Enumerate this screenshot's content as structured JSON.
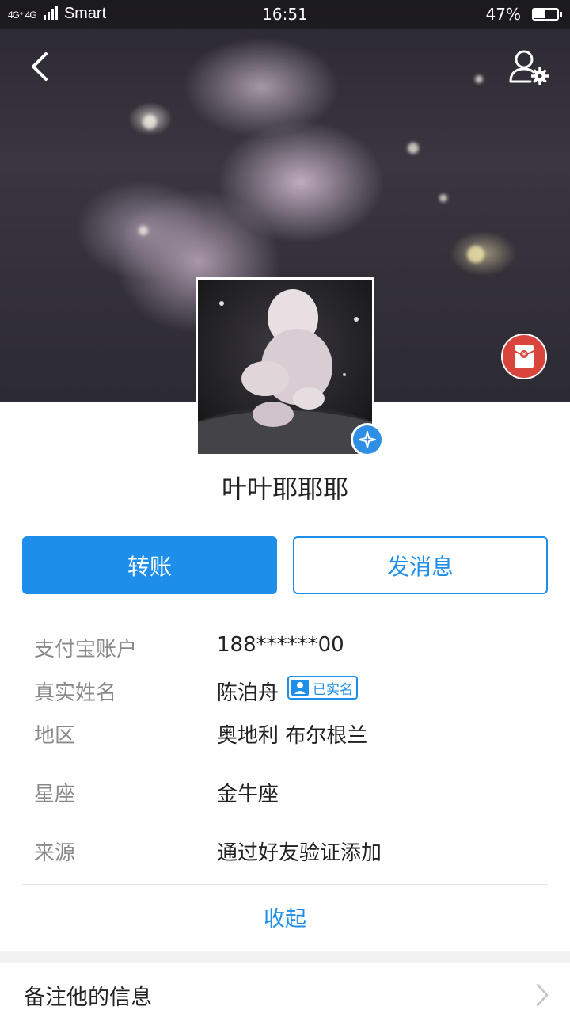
{
  "status_bar": {
    "network": "4G⁺ 4G",
    "carrier": "Smart",
    "time": "16:51",
    "battery": "47%",
    "battery_level": 0.47
  },
  "header": {
    "back_icon": "chevron-left-icon",
    "settings_icon": "user-settings-icon",
    "red_packet_icon": "red-packet-icon"
  },
  "profile": {
    "nickname": "叶叶耶耶耶",
    "verified_icon": "verified-star-icon"
  },
  "actions": {
    "transfer_label": "转账",
    "message_label": "发消息"
  },
  "info": [
    {
      "label": "支付宝账户",
      "value": "188******00"
    },
    {
      "label": "真实姓名",
      "value": "陈泊舟"
    },
    {
      "label": "地区",
      "value": "奥地利 布尔根兰"
    },
    {
      "label": "星座",
      "value": "金牛座"
    },
    {
      "label": "来源",
      "value": "通过好友验证添加"
    }
  ],
  "realname_badge": "已实名",
  "collapse_label": "收起",
  "remark": {
    "label": "备注他的信息"
  },
  "colors": {
    "accent": "#1d8ee9",
    "red_packet": "#d9443d"
  }
}
